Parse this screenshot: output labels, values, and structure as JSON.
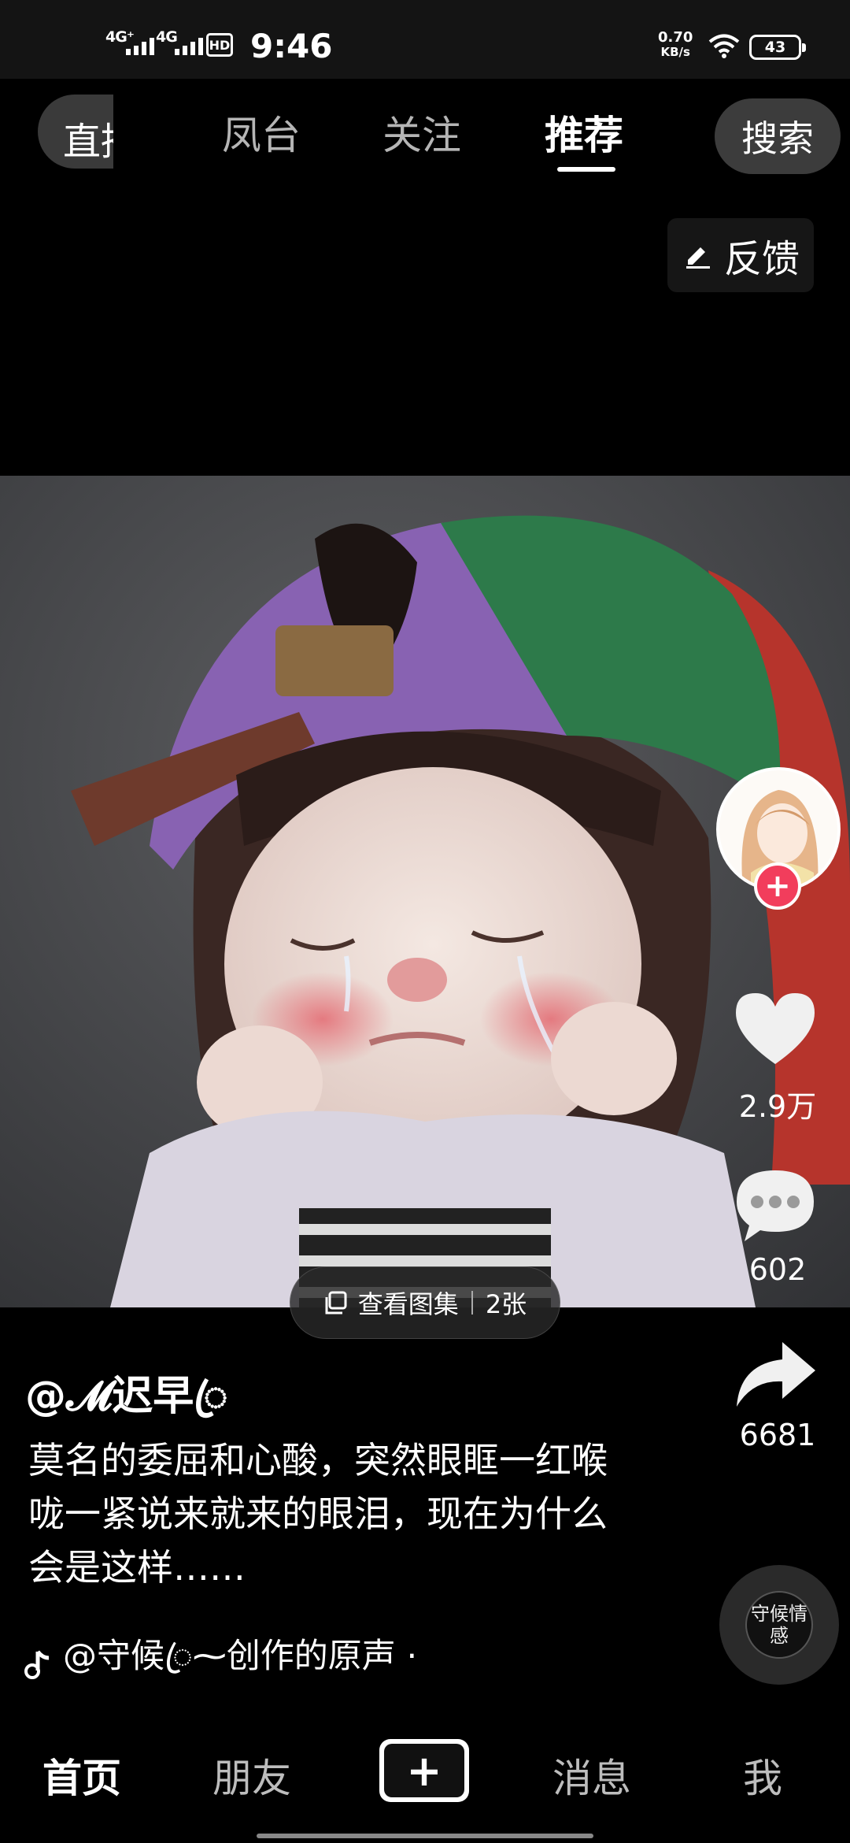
{
  "status_bar": {
    "network_1": "4G⁺",
    "network_2": "4G",
    "hd_label": "HD",
    "time": "9:46",
    "net_speed_value": "0.70",
    "net_speed_unit": "KB/s",
    "battery": "43"
  },
  "top_tabs": {
    "live": "直播",
    "tabs": [
      "凤台",
      "关注",
      "推荐"
    ],
    "active_tab": "推荐",
    "search": "搜索"
  },
  "feedback_label": "反馈",
  "gallery": {
    "label": "查看图集",
    "count": "2张"
  },
  "actions": {
    "likes": "2.9万",
    "comments": "602",
    "shares": "6681"
  },
  "post": {
    "author": "@𝓜迟早ꦿ",
    "description": "莫名的委屈和心酸，突然眼眶一红喉咙一紧说来就来的眼泪，现在为什么会是这样……",
    "music": "@守候ꦿ⁓创作的原声 ·",
    "disc_label": "守候情感"
  },
  "bottom_nav": {
    "home": "首页",
    "friends": "朋友",
    "create": "+",
    "messages": "消息",
    "me": "我"
  },
  "colors": {
    "accent_red": "#f23d5c",
    "background": "#000000"
  }
}
